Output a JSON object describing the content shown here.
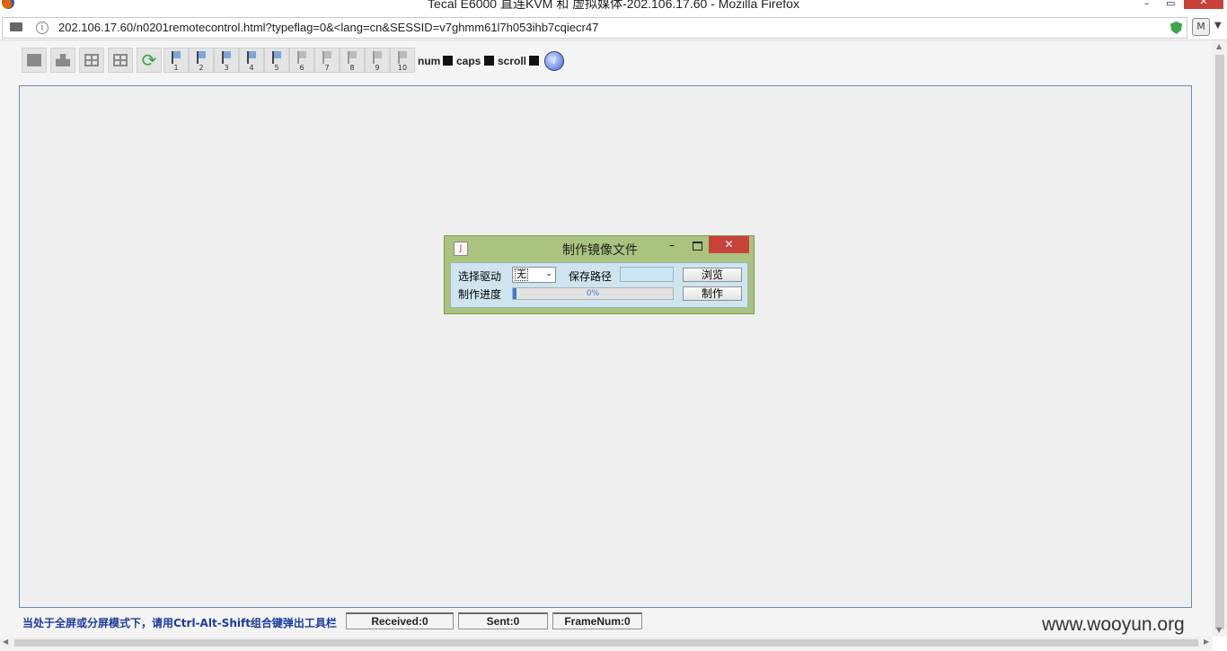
{
  "window": {
    "title": "Tecal E6000 直连KVM 和 虚拟媒体-202.106.17.60 - Mozilla Firefox",
    "minimize": "–",
    "restore": "▭",
    "close": "✕"
  },
  "address_bar": {
    "url": "202.106.17.60/n0201remotecontrol.html?typeflag=0&<lang=cn&SESSID=v7ghmm61l7h053ihb7cqiecr47",
    "info_glyph": "i",
    "extension_glyph": "M",
    "menu_arrow": "▼"
  },
  "toolbar": {
    "refresh_glyph": "⟳",
    "numbers": [
      "1",
      "2",
      "3",
      "4",
      "5",
      "6",
      "7",
      "8",
      "9",
      "10"
    ],
    "locks": {
      "num": "num",
      "caps": "caps",
      "scroll": "scroll"
    },
    "help_glyph": "i"
  },
  "dialog": {
    "title": "制作镜像文件",
    "java_glyph": "J",
    "minimize": "–",
    "close": "✕",
    "select_drive_label": "选择驱动",
    "drive_value": "无",
    "drive_arrow": "⌄",
    "save_path_label": "保存路径",
    "save_path_value": "",
    "browse_button": "浏览",
    "progress_label": "制作进度",
    "progress_text": "0%",
    "progress_value": 0,
    "make_button": "制作"
  },
  "status_bar": {
    "message": "当处于全屏或分屏模式下，请用Ctrl-Alt-Shift组合键弹出工具栏",
    "received": "Received:0",
    "sent": "Sent:0",
    "frame_num": "FrameNum:0"
  },
  "watermark": "www.wooyun.org",
  "colors": {
    "dialog_frame": "#aac37e",
    "dialog_body": "#cee5ef",
    "close_red": "#c8423c",
    "status_blue": "#1a3aa0"
  }
}
